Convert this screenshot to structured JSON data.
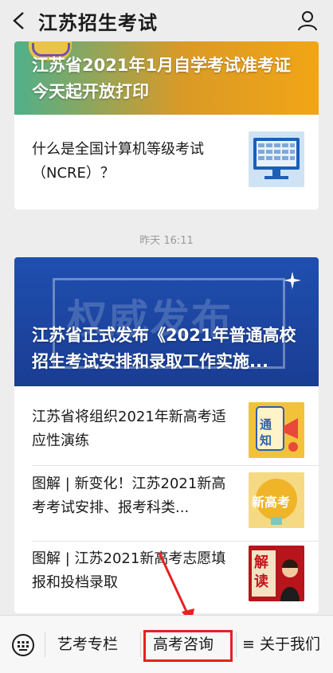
{
  "header": {
    "title": "江苏招生考试"
  },
  "card1": {
    "hero_title": "江苏省2021年1月自学考试准考证今天起开放打印",
    "item_text": "什么是全国计算机等级考试（NCRE）？"
  },
  "timestamp": "昨天 16:11",
  "card2": {
    "banner_text": "权威发布",
    "hero_title": "江苏省正式发布《2021年普通高校招生考试安排和录取工作实施...",
    "items": [
      {
        "text": "江苏省将组织2021年新高考适应性演练",
        "thumb_text": "通知"
      },
      {
        "text": "图解 | 新变化！江苏2021新高考考试安排、报考科类...",
        "thumb_text": "新高考"
      },
      {
        "text": "图解 | 江苏2021新高考志愿填报和投档录取",
        "thumb_text": "解读"
      }
    ]
  },
  "bottom_menu": {
    "items": [
      {
        "label": "艺考专栏"
      },
      {
        "label": "高考咨询"
      },
      {
        "label": "≡ 关于我们"
      }
    ]
  },
  "colors": {
    "highlight": "#e82020",
    "banner_blue": "#1f4fb0"
  }
}
